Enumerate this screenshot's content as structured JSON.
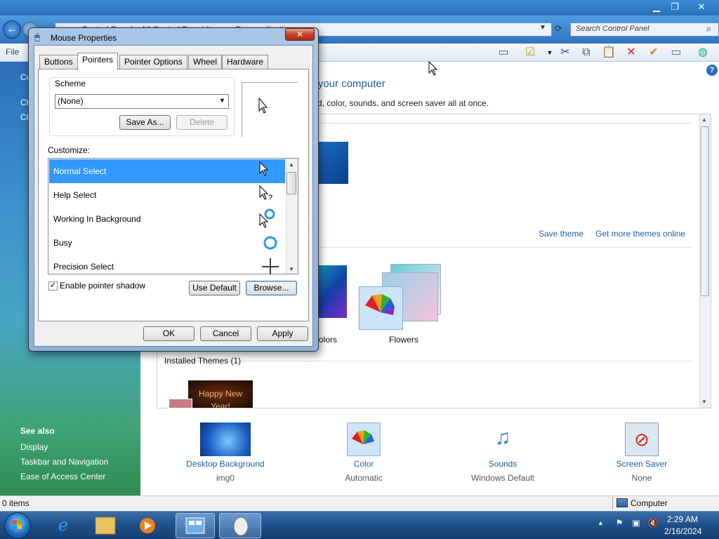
{
  "control_panel": {
    "address": {
      "segments_text": "Control Panel  ▸  All Control Panel Items  ▸  Personalization",
      "search_placeholder": "Search Control Panel"
    },
    "menu": {
      "file": "File"
    },
    "left_pane": {
      "links": [
        "Co",
        "Ch",
        "Ch"
      ],
      "see_also_heading": "See also",
      "see_also": [
        "Display",
        "Taskbar and Navigation",
        "Ease of Access Center"
      ]
    },
    "main": {
      "title": "on your computer",
      "subtitle": "ound, color, sounds, and screen saver all at once.",
      "save_theme": "Save theme",
      "get_more_themes": "Get more themes online",
      "partial_theme_label": "c",
      "colors_label": "colors",
      "flowers_label": "Flowers",
      "installed_themes": "Installed Themes (1)",
      "happy_text": "Happy New Year!"
    },
    "bottom": [
      {
        "label": "Desktop Background",
        "sub": "img0"
      },
      {
        "label": "Color",
        "sub": "Automatic"
      },
      {
        "label": "Sounds",
        "sub": "Windows Default"
      },
      {
        "label": "Screen Saver",
        "sub": "None"
      }
    ],
    "status": {
      "items": "0 items",
      "location": "Computer"
    }
  },
  "taskbar": {
    "time": "2:29 AM",
    "date": "2/16/2024"
  },
  "dialog": {
    "title": "Mouse Properties",
    "close": "✕",
    "tabs": [
      "Buttons",
      "Pointers",
      "Pointer Options",
      "Wheel",
      "Hardware"
    ],
    "active_tab": "Pointers",
    "scheme_label": "Scheme",
    "scheme_value": "(None)",
    "save_as": "Save As...",
    "delete": "Delete",
    "customize_label": "Customize:",
    "cursors": [
      {
        "name": "Normal Select",
        "selected": true
      },
      {
        "name": "Help Select",
        "selected": false
      },
      {
        "name": "Working In Background",
        "selected": false
      },
      {
        "name": "Busy",
        "selected": false
      },
      {
        "name": "Precision Select",
        "selected": false
      }
    ],
    "enable_shadow_label": "Enable pointer shadow",
    "enable_shadow_checked": true,
    "use_default": "Use Default",
    "browse": "Browse...",
    "ok": "OK",
    "cancel": "Cancel",
    "apply": "Apply"
  }
}
